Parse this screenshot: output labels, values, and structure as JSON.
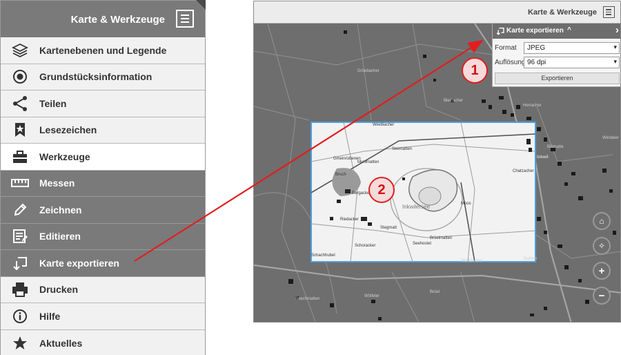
{
  "menu": {
    "title": "Karte & Werkzeuge",
    "items": [
      {
        "label": "Kartenebenen und Legende",
        "icon": "layers-icon",
        "state": "light"
      },
      {
        "label": "Grundstücksinformation",
        "icon": "radio-target-icon",
        "state": "light"
      },
      {
        "label": "Teilen",
        "icon": "share-icon",
        "state": "light"
      },
      {
        "label": "Lesezeichen",
        "icon": "bookmark-star-icon",
        "state": "light"
      },
      {
        "label": "Werkzeuge",
        "icon": "toolbox-icon",
        "state": "active"
      },
      {
        "label": "Messen",
        "icon": "ruler-icon",
        "state": "dark"
      },
      {
        "label": "Zeichnen",
        "icon": "pencil-icon",
        "state": "dark"
      },
      {
        "label": "Editieren",
        "icon": "edit-form-icon",
        "state": "dark"
      },
      {
        "label": "Karte exportieren",
        "icon": "export-map-icon",
        "state": "dark"
      },
      {
        "label": "Drucken",
        "icon": "printer-icon",
        "state": "light"
      },
      {
        "label": "Hilfe",
        "icon": "info-icon",
        "state": "light"
      },
      {
        "label": "Aktuelles",
        "icon": "star-icon",
        "state": "light"
      }
    ]
  },
  "map": {
    "header_title": "Karte & Werkzeuge",
    "export_panel": {
      "title": "Karte exportieren",
      "collapse_glyph": "^",
      "next_glyph": "›",
      "format_label": "Format",
      "format_value": "JPEG",
      "resolution_label": "Auflösung",
      "resolution_value": "96 dpi",
      "export_button": "Exportieren"
    },
    "controls": [
      "home-icon",
      "locate-icon",
      "zoom-in-icon",
      "zoom-out-icon"
    ],
    "control_glyphs": {
      "home": "⌂",
      "locate": "✧",
      "zoom_in": "+",
      "zoom_out": "−"
    },
    "place_labels": [
      {
        "text": "Weidliacher"
      },
      {
        "text": "Seematten"
      },
      {
        "text": "Gmeinrüttenen"
      },
      {
        "text": "Munimatten"
      },
      {
        "text": "Bruch"
      },
      {
        "text": "Bergacker"
      },
      {
        "text": "Inkwilersee"
      },
      {
        "text": "Moos"
      },
      {
        "text": "Chatzacher"
      },
      {
        "text": "Brüelmatten"
      },
      {
        "text": "Riedacker"
      },
      {
        "text": "Stegmatt"
      },
      {
        "text": "Schoracker"
      },
      {
        "text": "Seehostet"
      },
      {
        "text": "Schachhubel"
      },
      {
        "text": "Grüebacher"
      },
      {
        "text": "Bleicacher"
      },
      {
        "text": "Herracher"
      },
      {
        "text": "Inkwil"
      },
      {
        "text": "Wolfibacher"
      },
      {
        "text": "Buechmatten"
      },
      {
        "text": "Wölfeler"
      },
      {
        "text": "Brüel"
      },
      {
        "text": "Stalden"
      },
      {
        "text": "Blümatte"
      },
      {
        "text": "Windeler"
      }
    ]
  },
  "annotations": [
    {
      "number": "1"
    },
    {
      "number": "2"
    }
  ],
  "colors": {
    "menu_dark": "#7a7a7a",
    "menu_light": "#f1f1f1",
    "accent_red": "#e01e1e",
    "selection_blue": "#4a9fe0"
  }
}
